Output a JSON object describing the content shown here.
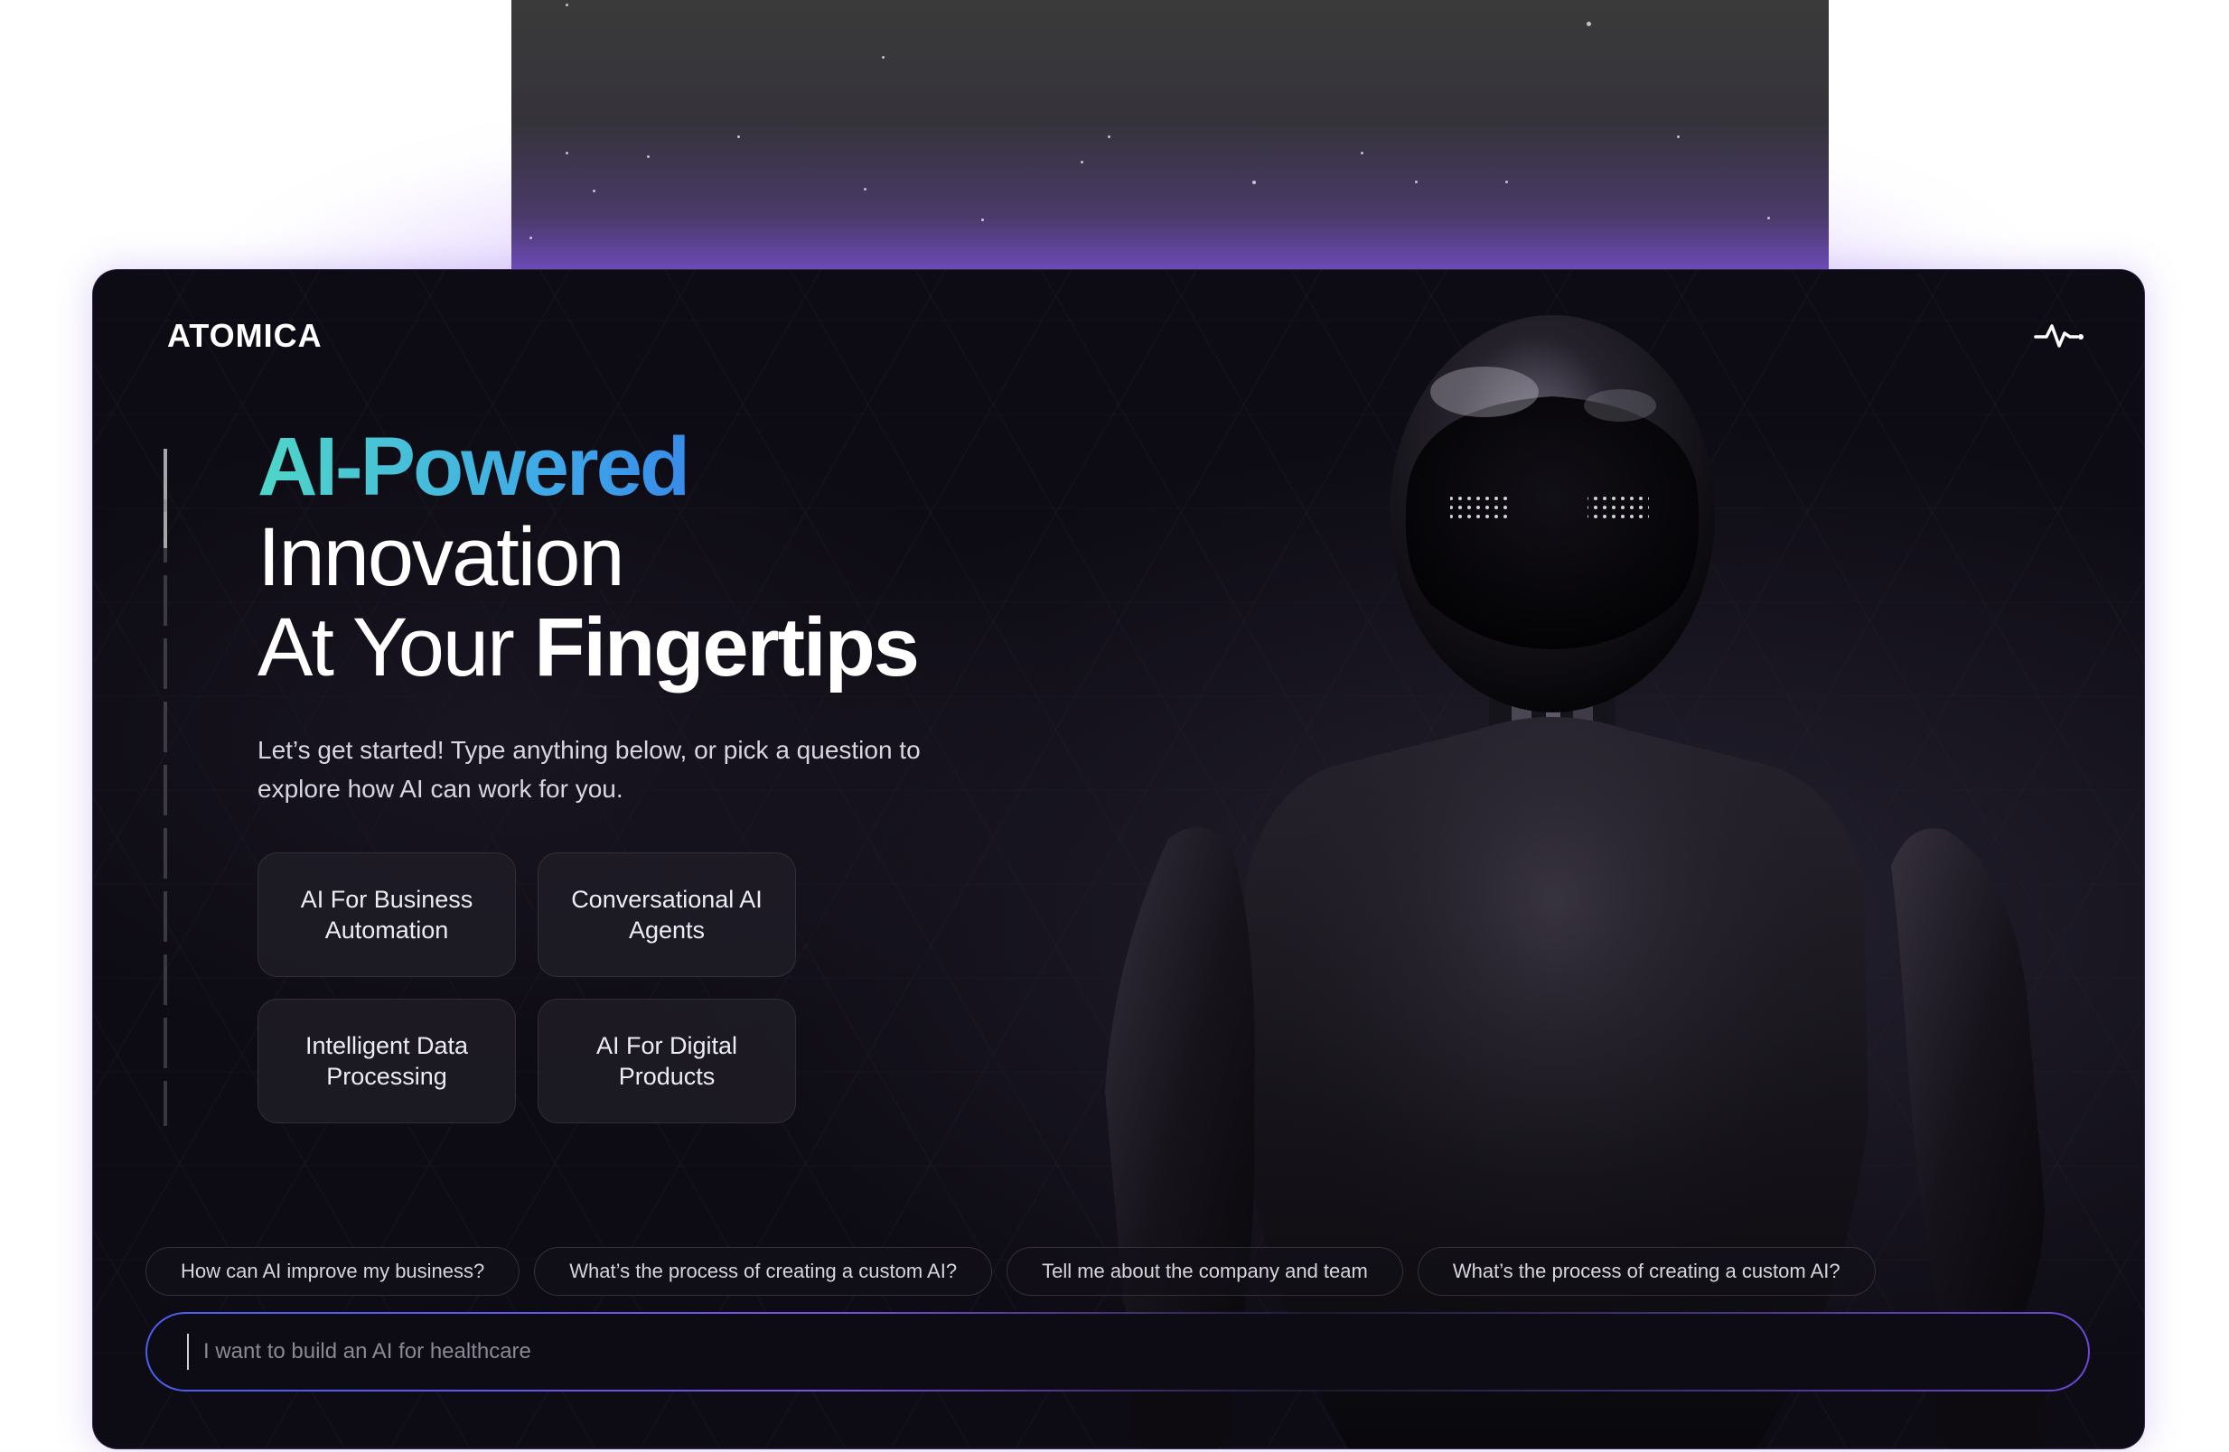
{
  "brand": {
    "logo": "ATOMICA"
  },
  "header": {
    "pulse_icon": "activity-pulse-icon"
  },
  "hero": {
    "line1": "AI-Powered",
    "line2": "Innovation",
    "line3_regular": "At Your ",
    "line3_bold": "Fingertips",
    "subtitle": "Let’s get started! Type anything below, or pick a question to explore how AI can work for you."
  },
  "topics": [
    {
      "label": "AI For Business Automation"
    },
    {
      "label": "Conversational AI Agents"
    },
    {
      "label": "Intelligent Data Processing"
    },
    {
      "label": "AI For Digital Products"
    }
  ],
  "suggestions": [
    {
      "label": "How can AI improve my business?"
    },
    {
      "label": "What’s the process of creating a custom AI?"
    },
    {
      "label": "Tell me about the company and team"
    },
    {
      "label": "What’s the process of creating a custom AI?"
    }
  ],
  "chat_input": {
    "placeholder": "I want to build an AI for healthcare",
    "value": ""
  },
  "colors": {
    "accent_gradient_start": "#4fd6c8",
    "accent_gradient_end": "#2a5ae8",
    "glow": "#8c50ff",
    "background": "#0c0a12"
  }
}
